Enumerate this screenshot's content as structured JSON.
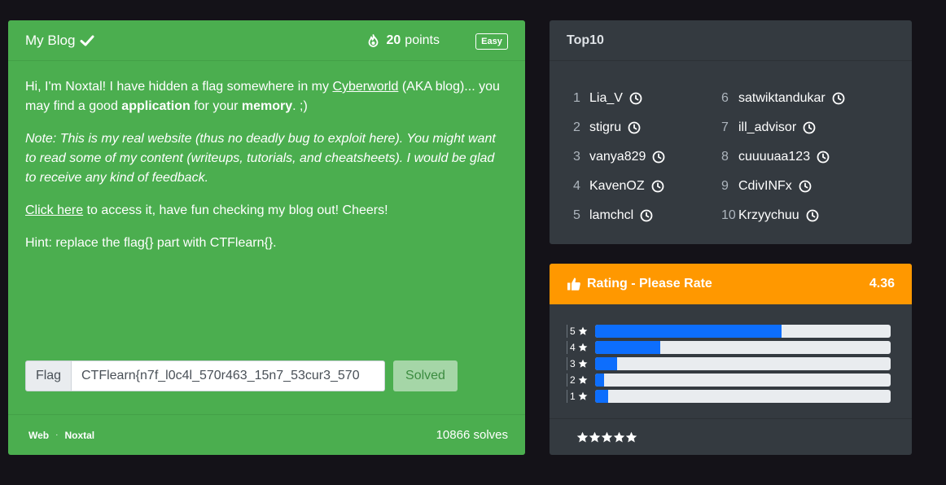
{
  "challenge": {
    "title": "My Blog",
    "points_value": "20",
    "points_label": "points",
    "difficulty": "Easy",
    "desc_p1_a": "Hi, I'm Noxtal! I have hidden a flag somewhere in my ",
    "desc_p1_link": "Cyberworld",
    "desc_p1_b": " (AKA blog)... you may find a good ",
    "desc_p1_bold1": "application",
    "desc_p1_c": " for your ",
    "desc_p1_bold2": "memory",
    "desc_p1_d": ". ;)",
    "note": "Note: This is my real website (thus no deadly bug to exploit here). You might want to read some of my content (writeups, tutorials, and cheatsheets). I would be glad to receive any kind of feedback.",
    "click_link": "Click here",
    "click_rest": " to access it, have fun checking my blog out! Cheers!",
    "hint": "Hint: replace the flag{} part with CTFlearn{}.",
    "flag_label": "Flag",
    "flag_value": "CTFlearn{n7f_l0c4l_570r463_15n7_53cur3_570",
    "solved_label": "Solved",
    "category": "Web",
    "author": "Noxtal",
    "solves": "10866 solves",
    "accent": "#4bae4f"
  },
  "top10": {
    "title": "Top10",
    "left": [
      {
        "rank": "1",
        "name": "Lia_V"
      },
      {
        "rank": "2",
        "name": "stigru"
      },
      {
        "rank": "3",
        "name": "vanya829"
      },
      {
        "rank": "4",
        "name": "KavenOZ"
      },
      {
        "rank": "5",
        "name": "lamchcl"
      }
    ],
    "right": [
      {
        "rank": "6",
        "name": "satwiktandukar"
      },
      {
        "rank": "7",
        "name": "ill_advisor"
      },
      {
        "rank": "8",
        "name": "cuuuuaa123"
      },
      {
        "rank": "9",
        "name": "CdivINFx"
      },
      {
        "rank": "10",
        "name": "Krzyychuu"
      }
    ]
  },
  "rating": {
    "title": "Rating - Please Rate",
    "score": "4.36",
    "accent": "#ff9800",
    "distribution": [
      {
        "stars": "5",
        "fraction": 0.63
      },
      {
        "stars": "4",
        "fraction": 0.22
      },
      {
        "stars": "3",
        "fraction": 0.075
      },
      {
        "stars": "2",
        "fraction": 0.03
      },
      {
        "stars": "1",
        "fraction": 0.045
      }
    ],
    "rate_stars": [
      "star-1",
      "star-2",
      "star-3",
      "star-4",
      "star-5"
    ]
  }
}
